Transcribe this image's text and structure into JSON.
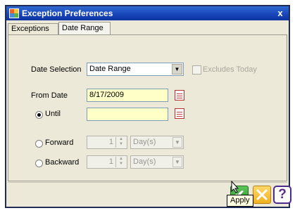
{
  "window": {
    "title": "Exception Preferences",
    "close_glyph": "x"
  },
  "tabs": [
    {
      "label": "Exceptions"
    },
    {
      "label": "Date Range",
      "active": true
    }
  ],
  "form": {
    "date_selection_label": "Date Selection",
    "date_selection_value": "Date Range",
    "excludes_today_label": "Excludes Today",
    "from_date_label": "From Date",
    "from_date_value": "8/17/2009",
    "until_label": "Until",
    "until_value": "",
    "forward_label": "Forward",
    "forward_value": "1",
    "forward_unit": "Day(s)",
    "backward_label": "Backward",
    "backward_value": "1",
    "backward_unit": "Day(s)"
  },
  "buttons": {
    "apply_tooltip": "Apply",
    "help_glyph": "?"
  },
  "colors": {
    "title_bar": "#1744b8",
    "date_field_bg": "#ffffc8",
    "apply_green": "#2a8f2a"
  }
}
